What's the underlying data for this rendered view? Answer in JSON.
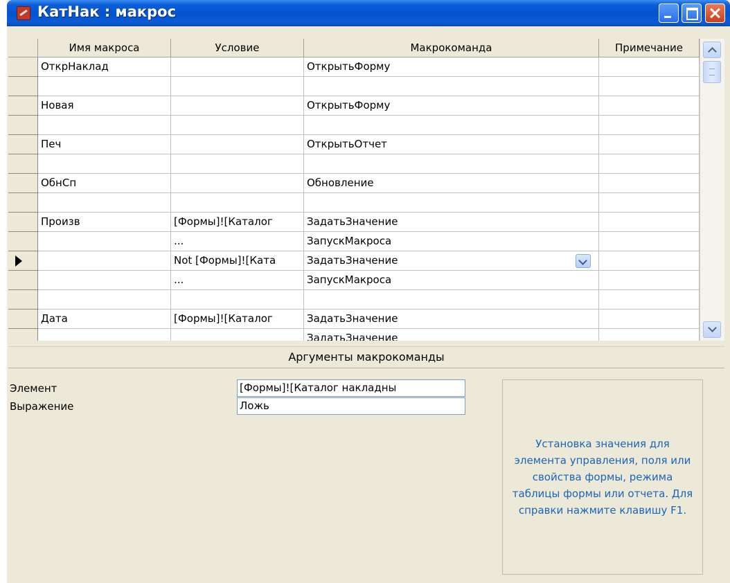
{
  "window": {
    "title": "КатНак : макрос"
  },
  "grid": {
    "columns": [
      {
        "label": "Имя макроса"
      },
      {
        "label": "Условие"
      },
      {
        "label": "Макрокоманда"
      },
      {
        "label": "Примечание"
      }
    ],
    "rows": [
      {
        "name": "ОткрНаклад",
        "condition": "",
        "action": "ОткрытьФорму",
        "note": ""
      },
      {
        "name": "",
        "condition": "",
        "action": "",
        "note": ""
      },
      {
        "name": "Новая",
        "condition": "",
        "action": "ОткрытьФорму",
        "note": ""
      },
      {
        "name": "",
        "condition": "",
        "action": "",
        "note": ""
      },
      {
        "name": "Печ",
        "condition": "",
        "action": "ОткрытьОтчет",
        "note": ""
      },
      {
        "name": "",
        "condition": "",
        "action": "",
        "note": ""
      },
      {
        "name": "ОбнСп",
        "condition": "",
        "action": "Обновление",
        "note": ""
      },
      {
        "name": "",
        "condition": "",
        "action": "",
        "note": ""
      },
      {
        "name": "Произв",
        "condition": "[Формы]![Каталог",
        "action": "ЗадатьЗначение",
        "note": ""
      },
      {
        "name": "",
        "condition": "...",
        "action": "ЗапускМакроса",
        "note": ""
      },
      {
        "name": "",
        "condition": "Not [Формы]![Ката",
        "action": "ЗадатьЗначение",
        "note": "",
        "current": true
      },
      {
        "name": "",
        "condition": "...",
        "action": "ЗапускМакроса",
        "note": ""
      },
      {
        "name": "",
        "condition": "",
        "action": "",
        "note": ""
      },
      {
        "name": "Дата",
        "condition": "[Формы]![Каталог",
        "action": "ЗадатьЗначение",
        "note": ""
      },
      {
        "name": "",
        "condition": "",
        "action": "ЗадатьЗначение",
        "note": ""
      }
    ]
  },
  "arguments": {
    "header": "Аргументы макрокоманды",
    "fields": [
      {
        "label": "Элемент",
        "value": "[Формы]![Каталог накладны"
      },
      {
        "label": "Выражение",
        "value": "Ложь"
      }
    ],
    "help": "Установка значения для элемента управления, поля или свойства формы, режима таблицы формы или отчета. Для справки нажмите клавишу F1."
  }
}
